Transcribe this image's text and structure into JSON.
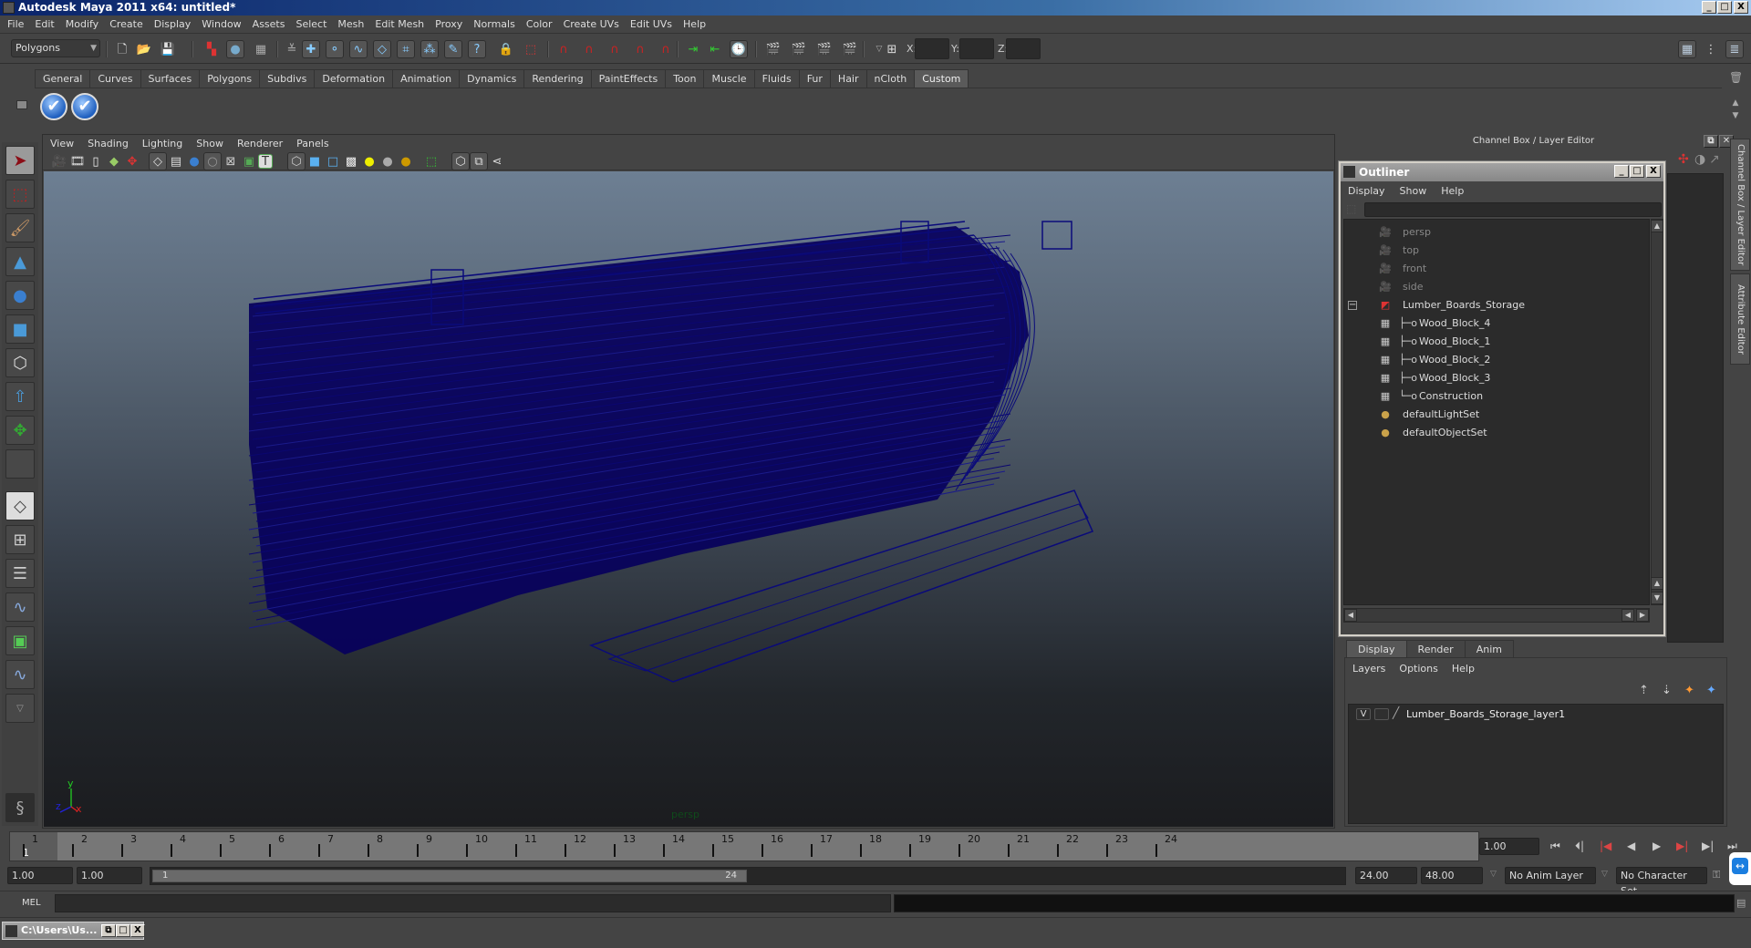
{
  "window": {
    "title": "Autodesk Maya 2011 x64: untitled*",
    "controls": {
      "minimize": "_",
      "maximize": "□",
      "close": "X"
    }
  },
  "menubar": [
    "File",
    "Edit",
    "Modify",
    "Create",
    "Display",
    "Window",
    "Assets",
    "Select",
    "Mesh",
    "Edit Mesh",
    "Proxy",
    "Normals",
    "Color",
    "Create UVs",
    "Edit UVs",
    "Help"
  ],
  "statusline": {
    "menuset": "Polygons",
    "icons": [
      "new-scene-icon",
      "open-scene-icon",
      "save-scene-icon",
      "select-by-hierarchy-icon",
      "select-by-object-icon",
      "select-by-component-icon",
      "snap-to-grid-icon",
      "snap-to-curve-icon",
      "snap-to-point-icon",
      "snap-to-view-plane-icon",
      "make-live-icon",
      "history-icon",
      "render-view-icon",
      "render-current-frame-icon",
      "ipr-render-icon",
      "render-settings-icon"
    ],
    "xyz_labels": {
      "x": "X:",
      "y": "Y:",
      "z": "Z:"
    },
    "xyz_values": {
      "x": "",
      "y": "",
      "z": ""
    }
  },
  "shelf": {
    "tabs": [
      "General",
      "Curves",
      "Surfaces",
      "Polygons",
      "Subdivs",
      "Deformation",
      "Animation",
      "Dynamics",
      "Rendering",
      "PaintEffects",
      "Toon",
      "Muscle",
      "Fluids",
      "Fur",
      "Hair",
      "nCloth",
      "Custom"
    ],
    "active_tab": "Custom",
    "buttons": [
      "checkmark-icon",
      "checkmark-icon"
    ]
  },
  "toolbox": {
    "tools": [
      "select-tool",
      "lasso-tool",
      "paint-select-tool",
      "move-tool",
      "rotate-tool",
      "scale-tool",
      "universal-manipulator",
      "soft-modification-tool",
      "show-manipulator-tool",
      "last-tool"
    ],
    "layouts": [
      "single-perspective-layout",
      "four-view-layout",
      "persp-outliner-layout",
      "persp-graph-layout",
      "hypershade-persp-layout",
      "persp-graph-hypergraph-layout"
    ]
  },
  "viewport": {
    "menus": [
      "View",
      "Shading",
      "Lighting",
      "Show",
      "Renderer",
      "Panels"
    ],
    "camera": "persp",
    "axis": {
      "x": "x",
      "y": "y",
      "z": "z"
    },
    "wire_color": "#06005c"
  },
  "channel_box": {
    "header": "Channel Box / Layer Editor",
    "side_tabs": [
      "Channel Box / Layer Editor",
      "Attribute Editor"
    ]
  },
  "outliner": {
    "title": "Outliner",
    "menus": [
      "Display",
      "Show",
      "Help"
    ],
    "filter": "",
    "items": [
      {
        "label": "persp",
        "type": "camera",
        "depth": 0,
        "dim": true
      },
      {
        "label": "top",
        "type": "camera",
        "depth": 0,
        "dim": true
      },
      {
        "label": "front",
        "type": "camera",
        "depth": 0,
        "dim": true
      },
      {
        "label": "side",
        "type": "camera",
        "depth": 0,
        "dim": true
      },
      {
        "label": "Lumber_Boards_Storage",
        "type": "group",
        "depth": 0,
        "expanded": true
      },
      {
        "label": "Wood_Block_4",
        "type": "mesh",
        "depth": 1
      },
      {
        "label": "Wood_Block_1",
        "type": "mesh",
        "depth": 1
      },
      {
        "label": "Wood_Block_2",
        "type": "mesh",
        "depth": 1
      },
      {
        "label": "Wood_Block_3",
        "type": "mesh",
        "depth": 1
      },
      {
        "label": "Construction",
        "type": "mesh",
        "depth": 1
      },
      {
        "label": "defaultLightSet",
        "type": "set",
        "depth": 0
      },
      {
        "label": "defaultObjectSet",
        "type": "set",
        "depth": 0
      }
    ]
  },
  "layer_editor": {
    "tabs": [
      "Display",
      "Render",
      "Anim"
    ],
    "active_tab": "Display",
    "menus": [
      "Layers",
      "Options",
      "Help"
    ],
    "layers": [
      {
        "visible": "V",
        "template": "",
        "name": "Lumber_Boards_Storage_layer1"
      }
    ]
  },
  "timeline": {
    "frames": [
      "1",
      "2",
      "3",
      "4",
      "5",
      "6",
      "7",
      "8",
      "9",
      "10",
      "11",
      "12",
      "13",
      "14",
      "15",
      "16",
      "17",
      "18",
      "19",
      "20",
      "21",
      "22",
      "23",
      "24"
    ],
    "current_frame_marker": "1",
    "current_time": "1.00"
  },
  "range": {
    "start_time": "1.00",
    "playback_start": "1.00",
    "slider_start": "1",
    "slider_end": "24",
    "playback_end": "24.00",
    "end_time": "48.00",
    "anim_layer": "No Anim Layer",
    "character_set": "No Character Set"
  },
  "command_line": {
    "label": "MEL",
    "value": ""
  },
  "minimized_window": {
    "title": "C:\\Users\\Us..."
  }
}
